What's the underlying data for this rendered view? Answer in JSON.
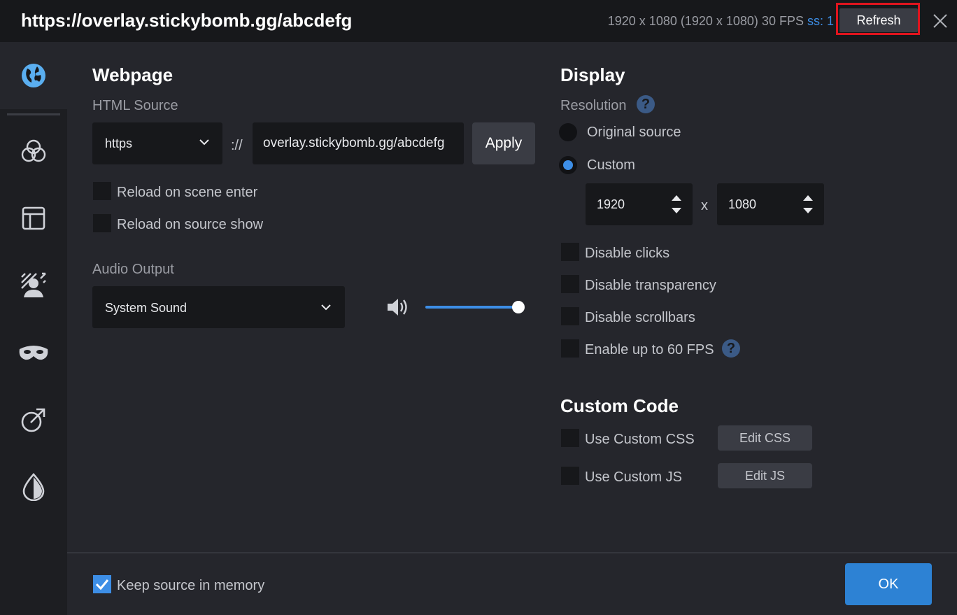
{
  "header": {
    "title": "https://overlay.stickybomb.gg/abcdefg",
    "stats": "1920 x 1080 (1920 x 1080) 30 FPS",
    "ss_label": "ss: 1",
    "refresh_label": "Refresh",
    "close_icon": "close-icon"
  },
  "sidebar": {
    "items": [
      {
        "icon": "globe-icon",
        "active": true
      },
      {
        "icon": "color-circles-icon"
      },
      {
        "icon": "layout-icon"
      },
      {
        "icon": "background-person-icon"
      },
      {
        "icon": "mask-icon"
      },
      {
        "icon": "link-arrow-icon"
      },
      {
        "icon": "contrast-drop-icon"
      }
    ]
  },
  "webpage": {
    "title": "Webpage",
    "html_source_label": "HTML Source",
    "protocol": "https",
    "separator": "://",
    "url": "overlay.stickybomb.gg/abcdefg",
    "apply_label": "Apply",
    "reload_scene_label": "Reload on scene enter",
    "reload_scene_checked": false,
    "reload_show_label": "Reload on source show",
    "reload_show_checked": false,
    "audio_output_label": "Audio Output",
    "audio_device": "System Sound",
    "volume_fraction": 1.0
  },
  "display": {
    "title": "Display",
    "resolution_label": "Resolution",
    "original_label": "Original source",
    "custom_label": "Custom",
    "selected": "custom",
    "width": "1920",
    "x_label": "x",
    "height": "1080",
    "disable_clicks_label": "Disable clicks",
    "disable_transparency_label": "Disable transparency",
    "disable_scrollbars_label": "Disable scrollbars",
    "enable60_label": "Enable up to 60 FPS"
  },
  "custom_code": {
    "title": "Custom Code",
    "css_label": "Use Custom CSS",
    "edit_css_label": "Edit CSS",
    "js_label": "Use Custom JS",
    "edit_js_label": "Edit JS"
  },
  "footer": {
    "keep_memory_label": "Keep source in memory",
    "keep_memory_checked": true,
    "ok_label": "OK"
  },
  "colors": {
    "accent": "#3d8ee6",
    "highlight_border": "#e0141e",
    "background": "#25262c",
    "titlebar": "#17181b"
  }
}
